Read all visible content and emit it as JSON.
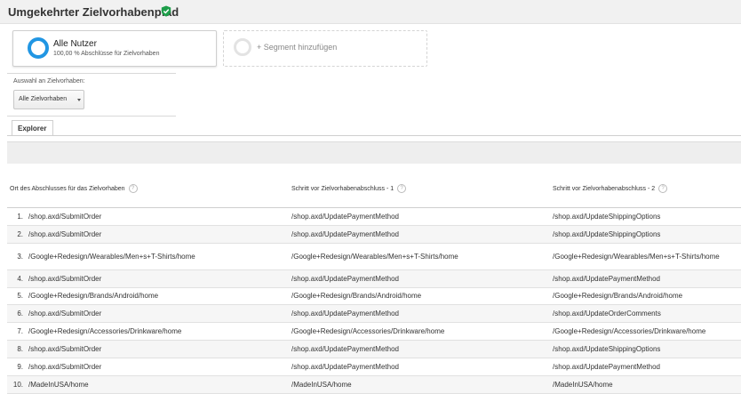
{
  "header": {
    "title": "Umgekehrter Zielvorhabenpfad",
    "verified_icon_color": "#1e9e4a"
  },
  "segments": {
    "active": {
      "name": "Alle Nutzer",
      "subtitle": "100,00 % Abschlüsse für Zielvorhaben",
      "ring_color": "#2196e3"
    },
    "add_label": "+ Segment hinzufügen"
  },
  "goal_select": {
    "label": "Auswahl an Zielvorhaben:",
    "value": "Alle Zielvorhaben"
  },
  "tabs": [
    {
      "label": "Explorer"
    }
  ],
  "table": {
    "columns": [
      "Ort des Abschlusses für das Zielvorhaben",
      "Schritt vor Zielvorhabenabschluss - 1",
      "Schritt vor Zielvorhabenabschluss - 2"
    ],
    "rows": [
      {
        "n": "1.",
        "c1": "/shop.axd/SubmitOrder",
        "c2": "/shop.axd/UpdatePaymentMethod",
        "c3": "/shop.axd/UpdateShippingOptions"
      },
      {
        "n": "2.",
        "c1": "/shop.axd/SubmitOrder",
        "c2": "/shop.axd/UpdatePaymentMethod",
        "c3": "/shop.axd/UpdateShippingOptions"
      },
      {
        "n": "3.",
        "c1": "/Google+Redesign/Wearables/Men+s+T-Shirts/home",
        "c2": "/Google+Redesign/Wearables/Men+s+T-Shirts/home",
        "c3": "/Google+Redesign/Wearables/Men+s+T-Shirts/home"
      },
      {
        "n": "4.",
        "c1": "/shop.axd/SubmitOrder",
        "c2": "/shop.axd/UpdatePaymentMethod",
        "c3": "/shop.axd/UpdatePaymentMethod"
      },
      {
        "n": "5.",
        "c1": "/Google+Redesign/Brands/Android/home",
        "c2": "/Google+Redesign/Brands/Android/home",
        "c3": "/Google+Redesign/Brands/Android/home"
      },
      {
        "n": "6.",
        "c1": "/shop.axd/SubmitOrder",
        "c2": "/shop.axd/UpdatePaymentMethod",
        "c3": "/shop.axd/UpdateOrderComments"
      },
      {
        "n": "7.",
        "c1": "/Google+Redesign/Accessories/Drinkware/home",
        "c2": "/Google+Redesign/Accessories/Drinkware/home",
        "c3": "/Google+Redesign/Accessories/Drinkware/home"
      },
      {
        "n": "8.",
        "c1": "/shop.axd/SubmitOrder",
        "c2": "/shop.axd/UpdatePaymentMethod",
        "c3": "/shop.axd/UpdateShippingOptions"
      },
      {
        "n": "9.",
        "c1": "/shop.axd/SubmitOrder",
        "c2": "/shop.axd/UpdatePaymentMethod",
        "c3": "/shop.axd/UpdatePaymentMethod"
      },
      {
        "n": "10.",
        "c1": "/MadeInUSA/home",
        "c2": "/MadeInUSA/home",
        "c3": "/MadeInUSA/home"
      }
    ]
  }
}
